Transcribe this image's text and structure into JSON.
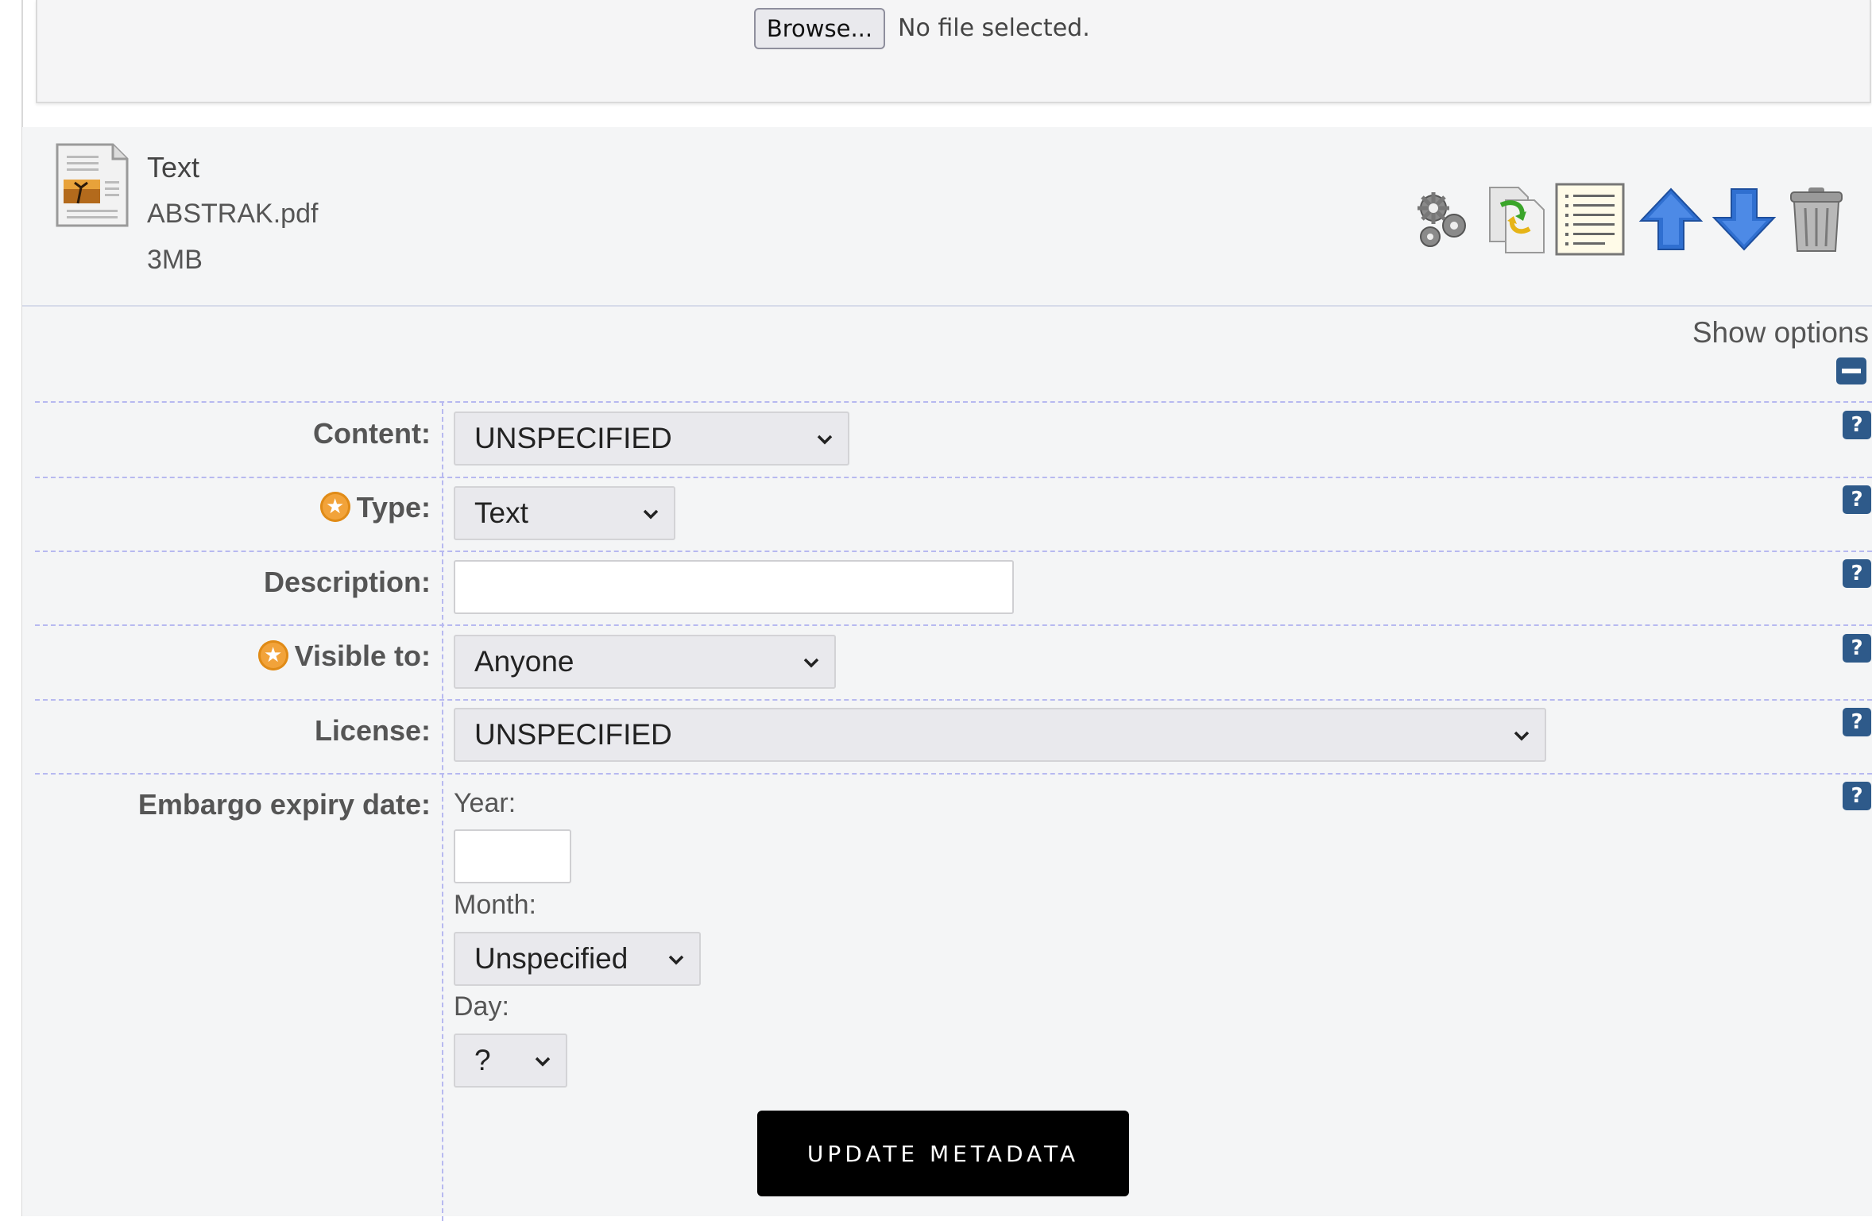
{
  "upload": {
    "browse_label": "Browse...",
    "status": "No file selected."
  },
  "document": {
    "title": "Text",
    "filename": "ABSTRAK.pdf",
    "size": "3MB",
    "icons": [
      "pdf-document-icon",
      "settings-gears-icon",
      "replace-file-icon",
      "details-list-icon",
      "move-up-arrow-icon",
      "move-down-arrow-icon",
      "trash-icon"
    ]
  },
  "options": {
    "toggle_label": "Show options"
  },
  "form": {
    "content": {
      "label": "Content:",
      "value": "UNSPECIFIED"
    },
    "type": {
      "label": "Type:",
      "value": "Text",
      "required": true
    },
    "description": {
      "label": "Description:",
      "value": ""
    },
    "visible_to": {
      "label": "Visible to:",
      "value": "Anyone",
      "required": true
    },
    "license": {
      "label": "License:",
      "value": "UNSPECIFIED"
    },
    "embargo": {
      "label": "Embargo expiry date:",
      "year_label": "Year:",
      "year_value": "",
      "month_label": "Month:",
      "month_value": "Unspecified",
      "day_label": "Day:",
      "day_value": "?"
    },
    "help_glyph": "?"
  },
  "submit": {
    "label": "UPDATE METADATA"
  },
  "colors": {
    "panel_bg": "#f4f5f6",
    "help_icon": "#2e5a8a",
    "required_star": "#f2a33a",
    "row_divider": "#b7b9f0",
    "primary_button": "#000000"
  }
}
